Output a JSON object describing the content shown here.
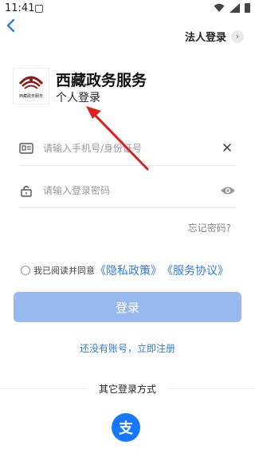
{
  "status_bar": {
    "time": "11:41",
    "indicator": "A"
  },
  "header": {
    "back_icon": "back-chevron-icon",
    "corp_login_label": "法人登录",
    "corp_chevron": "›"
  },
  "brand": {
    "logo_text": "西藏政务服务",
    "title": "西藏政务服务",
    "subtitle": "个人登录"
  },
  "form": {
    "account_placeholder": "请输入手机号/身份证号",
    "account_value": "",
    "password_placeholder": "请输入登录密码",
    "password_value": "",
    "forgot_label": "忘记密码?"
  },
  "agreement": {
    "prefix": "我已阅读并同意",
    "privacy_label": "《隐私政策》",
    "service_label": "《服务协议》"
  },
  "login_button_label": "登录",
  "register_label": "还没有账号，立即注册",
  "other_login_label": "其它登录方式",
  "alipay_glyph": "支",
  "colors": {
    "primary_link": "#2f7bd8",
    "login_button": "#98b9ee",
    "alipay": "#1677ff",
    "annotation_arrow": "#e02020"
  }
}
